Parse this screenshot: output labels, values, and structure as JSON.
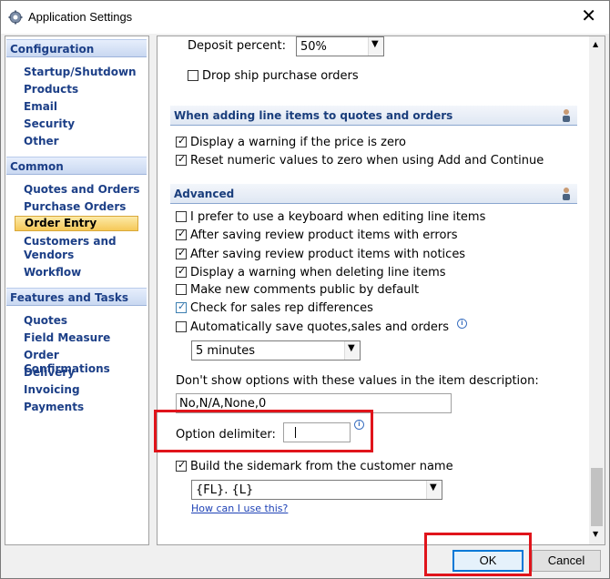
{
  "window": {
    "title": "Application Settings"
  },
  "sidebar": {
    "sections": [
      {
        "title": "Configuration",
        "items": [
          "Startup/Shutdown",
          "Products",
          "Email",
          "Security",
          "Other"
        ]
      },
      {
        "title": "Common",
        "items": [
          "Quotes and Orders",
          "Purchase Orders",
          "Order Entry",
          "Customers and",
          "Vendors",
          "Workflow"
        ]
      },
      {
        "title": "Features and Tasks",
        "items": [
          "Quotes",
          "Field Measure",
          "Order Confirmations",
          "Delivery",
          "Invoicing",
          "Payments"
        ]
      }
    ],
    "active_item": "Order Entry"
  },
  "main": {
    "deposit": {
      "label": "Deposit percent:",
      "value": "50%"
    },
    "drop_ship": {
      "label": "Drop ship purchase orders",
      "checked": false
    },
    "line_items_section": {
      "title": "When adding line items to quotes and orders",
      "options": [
        {
          "label": "Display a warning if the price is zero",
          "checked": true
        },
        {
          "label": "Reset numeric values to zero when using Add and Continue",
          "checked": true
        }
      ]
    },
    "advanced_section": {
      "title": "Advanced",
      "options": [
        {
          "label": "I prefer to use a keyboard when editing line items",
          "checked": false
        },
        {
          "label": "After saving review product items with errors",
          "checked": true
        },
        {
          "label": "After saving review product items with notices",
          "checked": true
        },
        {
          "label": "Display a warning when deleting line items",
          "checked": true
        },
        {
          "label": "Make new comments public by default",
          "checked": false
        },
        {
          "label": "Check for sales rep differences",
          "checked": true
        },
        {
          "label": "Automatically save quotes,sales and orders",
          "checked": false
        }
      ],
      "autosave_interval": "5 minutes",
      "hide_options_label": "Don't show options with these values in the item description:",
      "hide_options_value": "No,N/A,None,0",
      "option_delimiter_label": "Option delimiter:",
      "option_delimiter_value": "",
      "sidemark": {
        "label": "Build the sidemark from the customer name",
        "checked": true
      },
      "sidemark_format": "{FL}. {L}",
      "help_link": "How can I use this?"
    }
  },
  "footer": {
    "ok_label": "OK",
    "cancel_label": "Cancel"
  },
  "icons": {
    "app": "gear-icon",
    "close": "close-icon",
    "user": "user-icon",
    "info": "info-icon",
    "dropdown": "chevron-down-icon"
  },
  "colors": {
    "sidebar_header_text": "#1c3f87",
    "active_item_bg": "#f6c958",
    "highlight_red": "#e0141b",
    "ok_button_border": "#0078d7"
  }
}
